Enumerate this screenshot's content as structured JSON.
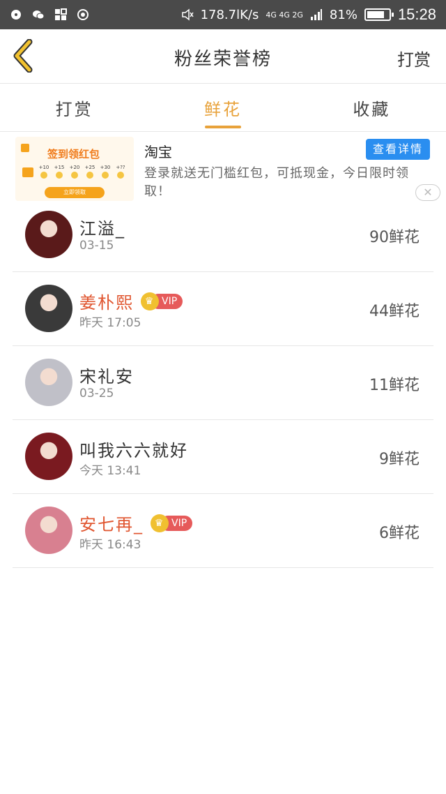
{
  "status_bar": {
    "speed": "178.7lK/s",
    "network": "4G 4G 2G",
    "battery": "81%",
    "battery_fraction": 0.81,
    "time": "15:28"
  },
  "header": {
    "title": "粉丝荣誉榜",
    "right_action": "打赏"
  },
  "tabs": [
    {
      "label": "打赏",
      "active": false
    },
    {
      "label": "鲜花",
      "active": true
    },
    {
      "label": "收藏",
      "active": false
    }
  ],
  "ad": {
    "image_title": "签到领红包",
    "image_coins": [
      "+10",
      "+15",
      "+20",
      "+25",
      "+30",
      "+??"
    ],
    "image_button": "立即领取",
    "brand": "淘宝",
    "description": "登录就送无门槛红包，可抵现金，今日限时领取！",
    "cta": "查看详情",
    "close": "✕"
  },
  "fans": [
    {
      "name": "江溢_",
      "date": "03-15",
      "amount": "90鲜花",
      "vip": false,
      "avatar_color": "#5a1a1a"
    },
    {
      "name": "姜朴熙",
      "date": "昨天 17:05",
      "amount": "44鲜花",
      "vip": true,
      "vip_label": "VIP",
      "avatar_color": "#3a3a3a"
    },
    {
      "name": "宋礼安",
      "date": "03-25",
      "amount": "11鲜花",
      "vip": false,
      "avatar_color": "#c0c0c8"
    },
    {
      "name": "叫我六六就好",
      "date": "今天 13:41",
      "amount": "9鲜花",
      "vip": false,
      "avatar_color": "#7a1a20"
    },
    {
      "name": "安七再_",
      "date": "昨天 16:43",
      "amount": "6鲜花",
      "vip": true,
      "vip_label": "VIP",
      "avatar_color": "#d88090"
    }
  ],
  "colors": {
    "accent": "#e8a23a",
    "vip_name": "#e0552f",
    "cta_blue": "#2a8ef0"
  }
}
